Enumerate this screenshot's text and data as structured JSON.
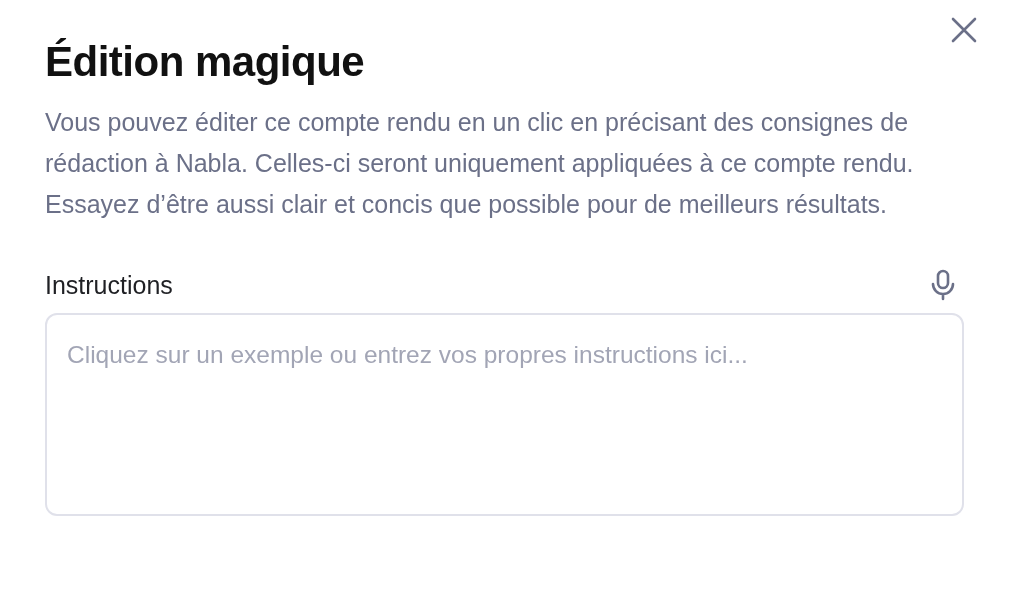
{
  "dialog": {
    "title": "Édition magique",
    "description": "Vous pouvez éditer ce compte rendu en un clic en précisant des consignes de rédaction à Nabla. Celles-ci seront uniquement appliquées à ce compte rendu. Essayez d’être aussi clair et concis que possible pour de meilleurs résultats."
  },
  "instructions": {
    "label": "Instructions",
    "placeholder": "Cliquez sur un exemple ou entrez vos propres instructions ici..."
  }
}
